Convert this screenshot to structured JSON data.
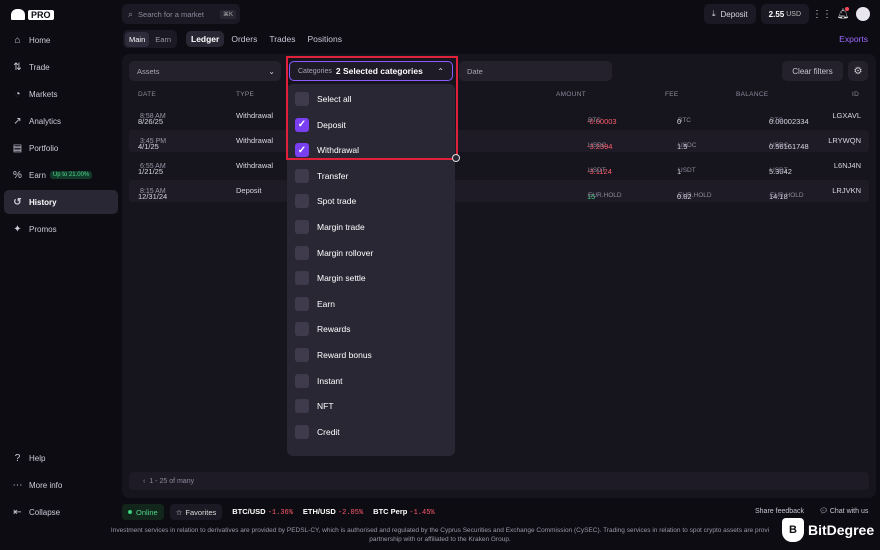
{
  "brand": {
    "logo_label": "PRO"
  },
  "search": {
    "placeholder": "Search for a market",
    "shortcut": "⌘K"
  },
  "topbar": {
    "deposit_label": "Deposit",
    "balance_value": "2.55",
    "balance_unit": "USD"
  },
  "sidebar": {
    "items": [
      {
        "label": "Home",
        "icon": "home-icon",
        "glyph": "⌂"
      },
      {
        "label": "Trade",
        "icon": "trade-icon",
        "glyph": "⇅"
      },
      {
        "label": "Markets",
        "icon": "markets-icon",
        "glyph": "◔"
      },
      {
        "label": "Analytics",
        "icon": "analytics-icon",
        "glyph": "↗"
      },
      {
        "label": "Portfolio",
        "icon": "portfolio-icon",
        "glyph": "▤"
      },
      {
        "label": "Earn",
        "icon": "earn-icon",
        "glyph": "%",
        "badge": "Up to 21.00%"
      },
      {
        "label": "History",
        "icon": "history-icon",
        "glyph": "↺"
      },
      {
        "label": "Promos",
        "icon": "promos-icon",
        "glyph": "✦"
      }
    ],
    "bottom": [
      {
        "label": "Help",
        "icon": "help-icon",
        "glyph": "?"
      },
      {
        "label": "More info",
        "icon": "more-icon",
        "glyph": "⋯"
      },
      {
        "label": "Collapse",
        "icon": "collapse-icon",
        "glyph": "⇤"
      }
    ]
  },
  "subnav": {
    "main": "Main",
    "earn": "Earn"
  },
  "tabs": [
    "Ledger",
    "Orders",
    "Trades",
    "Positions"
  ],
  "exports_label": "Exports",
  "filters": {
    "assets": "Assets",
    "categories_label": "Categories",
    "categories_value": "2 Selected categories",
    "date": "Date",
    "clear": "Clear filters"
  },
  "table": {
    "headers": {
      "date": "DATE",
      "type": "TYPE",
      "amount": "AMOUNT",
      "fee": "FEE",
      "balance": "BALANCE",
      "id": "ID"
    },
    "rows": [
      {
        "date": "8/26/25",
        "time": "8:58 AM",
        "type": "Withdrawal",
        "amount": "-0.00003",
        "amount_unit": "BTC",
        "fee": "0",
        "fee_unit": "BTC",
        "balance": "0.00002334",
        "balance_unit": "BTC",
        "id": "LGXAVL"
      },
      {
        "date": "4/1/25",
        "time": "3:45 PM",
        "type": "Withdrawal",
        "amount": "-3.2394",
        "amount_unit": "USDC",
        "fee": "1.5",
        "fee_unit": "USDC",
        "balance": "0.56161748",
        "balance_unit": "USDC",
        "id": "LRYWQN"
      },
      {
        "date": "1/21/25",
        "time": "6:55 AM",
        "type": "Withdrawal",
        "amount": "-3.1124",
        "amount_unit": "USDT",
        "fee": "1",
        "fee_unit": "USDT",
        "balance": "5.3042",
        "balance_unit": "USDT",
        "id": "L6NJ4N"
      },
      {
        "date": "12/31/24",
        "time": "8:15 AM",
        "type": "Deposit",
        "amount": "15",
        "amount_unit": "EUR.HOLD",
        "fee": "0.82",
        "fee_unit": "EUR.HOLD",
        "balance": "14.18",
        "balance_unit": "EUR.HOLD",
        "id": "LRJVKN"
      }
    ],
    "pager": "1 - 25 of many"
  },
  "dropdown": {
    "items": [
      {
        "label": "Select all",
        "checked": false
      },
      {
        "label": "Deposit",
        "checked": true
      },
      {
        "label": "Withdrawal",
        "checked": true
      },
      {
        "label": "Transfer",
        "checked": false
      },
      {
        "label": "Spot trade",
        "checked": false
      },
      {
        "label": "Margin trade",
        "checked": false
      },
      {
        "label": "Margin rollover",
        "checked": false
      },
      {
        "label": "Margin settle",
        "checked": false
      },
      {
        "label": "Earn",
        "checked": false
      },
      {
        "label": "Rewards",
        "checked": false
      },
      {
        "label": "Reward bonus",
        "checked": false
      },
      {
        "label": "Instant",
        "checked": false
      },
      {
        "label": "NFT",
        "checked": false
      },
      {
        "label": "Credit",
        "checked": false
      }
    ]
  },
  "status": {
    "online": "Online",
    "favorites": "Favorites",
    "tickers": [
      {
        "pair": "BTC/USD",
        "change": "-1.36%"
      },
      {
        "pair": "ETH/USD",
        "change": "-2.05%"
      },
      {
        "pair": "BTC Perp",
        "change": "-1.45%"
      }
    ],
    "share": "Share feedback",
    "chat": "Chat with us"
  },
  "footer": {
    "line1": "Investment services in relation to derivatives are provided by PEDSL-CY, which is authorised and regulated by the Cyprus Securities and Exchange Commission (CySEC). Trading services in relation to spot crypto assets are provi",
    "line2": "partnership with or affiliated to the Kraken Group."
  },
  "watermark": "BitDegree",
  "colors": {
    "accent": "#7b3ff2",
    "negative": "#ff5c6c",
    "positive": "#3ad07c",
    "highlight": "#e0213a"
  }
}
